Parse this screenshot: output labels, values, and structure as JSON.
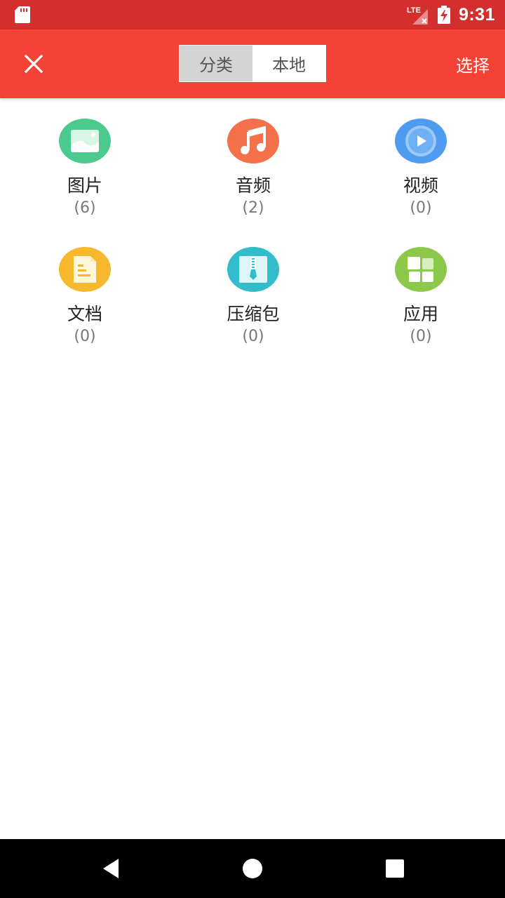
{
  "status_bar": {
    "network": "LTE",
    "time": "9:31"
  },
  "toolbar": {
    "close_icon": "close-icon",
    "tabs": [
      {
        "label": "分类",
        "active": true
      },
      {
        "label": "本地",
        "active": false
      }
    ],
    "select_label": "选择"
  },
  "categories": [
    {
      "label": "图片",
      "count": "(6)",
      "icon": "image-icon",
      "color": "#4cc98c"
    },
    {
      "label": "音频",
      "count": "(2)",
      "icon": "music-icon",
      "color": "#f4714b"
    },
    {
      "label": "视频",
      "count": "(0)",
      "icon": "video-play-icon",
      "color": "#4d9cf0"
    },
    {
      "label": "文档",
      "count": "(0)",
      "icon": "document-icon",
      "color": "#f6b92e"
    },
    {
      "label": "压缩包",
      "count": "(0)",
      "icon": "zip-archive-icon",
      "color": "#33bcc9"
    },
    {
      "label": "应用",
      "count": "(0)",
      "icon": "apps-grid-icon",
      "color": "#8cc94a"
    }
  ],
  "nav_bar": {
    "back_icon": "back-triangle-icon",
    "home_icon": "home-circle-icon",
    "recents_icon": "recents-square-icon"
  },
  "colors": {
    "status_bar": "#d32f2f",
    "toolbar": "#f44336",
    "tab_active_bg": "#d4d4d4"
  }
}
